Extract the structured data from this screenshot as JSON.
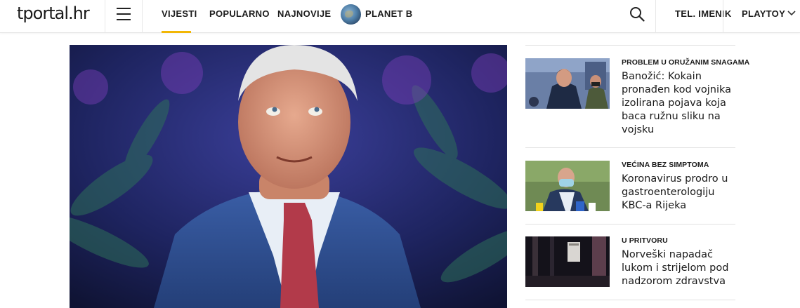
{
  "header": {
    "logo": "tportal.hr",
    "nav": [
      {
        "label": "VIJESTI"
      },
      {
        "label": "POPULARNO"
      },
      {
        "label": "NAJNOVIJE"
      },
      {
        "label": "PLANET B"
      }
    ],
    "right_nav": [
      {
        "label": "TEL. IMENIK"
      },
      {
        "label": "PLAYTOY"
      }
    ],
    "accent_color": "#f2b705"
  },
  "sidebar": {
    "articles": [
      {
        "kicker": "PROBLEM U ORUŽANIM SNAGAMA",
        "title": "Banožić: Kokain pronađen kod vojnika izolirana pojava koja baca ružnu sliku na vojsku"
      },
      {
        "kicker": "VEĆINA BEZ SIMPTOMA",
        "title": "Koronavirus prodro u gastroenterologiju KBC-a Rijeka"
      },
      {
        "kicker": "U PRITVORU",
        "title": "Norveški napadač lukom i strijelom pod nadzorom zdravstva"
      }
    ]
  }
}
